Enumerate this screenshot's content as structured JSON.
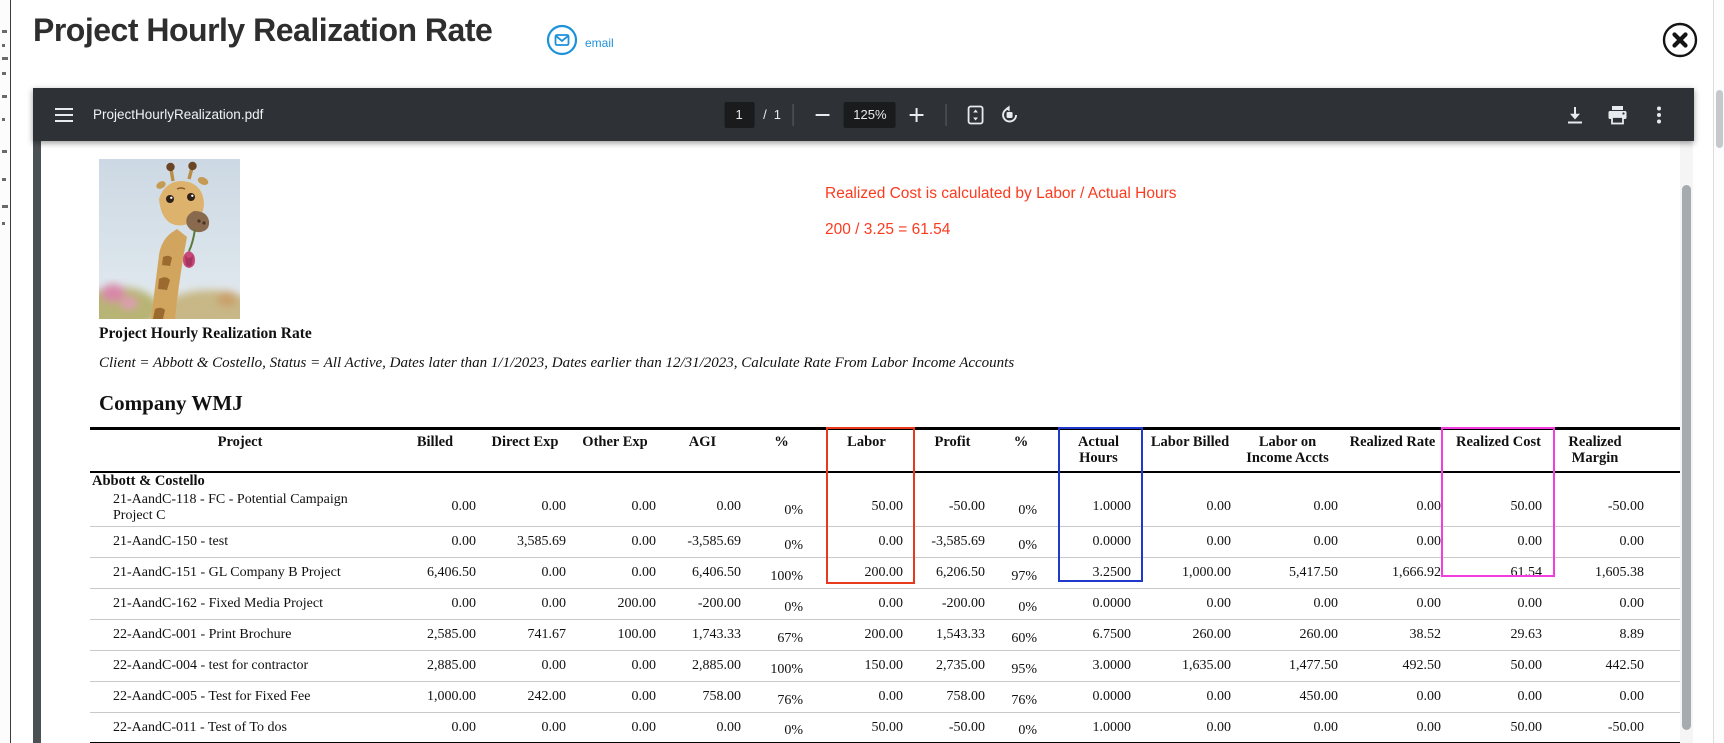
{
  "app": {
    "title": "Project Hourly Realization Rate",
    "email_label": "email",
    "accent_blue": "#1d91d9"
  },
  "pdf_toolbar": {
    "filename": "ProjectHourlyRealization.pdf",
    "page_current": "1",
    "page_divider": "/",
    "page_total": "1",
    "zoom_level": "125%"
  },
  "document": {
    "logo_icon": "giraffe-with-tulip-photo",
    "annotation": {
      "line1": "Realized Cost is calculated by Labor / Actual Hours",
      "line2": "200 / 3.25 = 61.54",
      "color": "#fb3a1e"
    },
    "report_title": "Project Hourly Realization Rate",
    "filter_line": "Client = Abbott & Costello, Status = All Active, Dates later than 1/1/2023, Dates earlier than 12/31/2023, Calculate Rate From Labor Income Accounts",
    "company_heading": "Company WMJ",
    "table": {
      "columns": [
        "Project",
        "Billed",
        "Direct Exp",
        "Other Exp",
        "AGI",
        "%",
        "Labor",
        "Profit",
        "%",
        "Actual Hours",
        "Labor Billed",
        "Labor on Income Accts",
        "Realized Rate",
        "Realized Cost",
        "Realized Margin"
      ],
      "group_header": "Abbott & Costello",
      "rows": [
        [
          "21-AandC-118 - FC - Potential Campaign Project C",
          "0.00",
          "0.00",
          "0.00",
          "0.00",
          "0%",
          "50.00",
          "-50.00",
          "0%",
          "1.0000",
          "0.00",
          "0.00",
          "0.00",
          "50.00",
          "-50.00"
        ],
        [
          "21-AandC-150 - test",
          "0.00",
          "3,585.69",
          "0.00",
          "-3,585.69",
          "0%",
          "0.00",
          "-3,585.69",
          "0%",
          "0.0000",
          "0.00",
          "0.00",
          "0.00",
          "0.00",
          "0.00"
        ],
        [
          "21-AandC-151 - GL Company B Project",
          "6,406.50",
          "0.00",
          "0.00",
          "6,406.50",
          "100%",
          "200.00",
          "6,206.50",
          "97%",
          "3.2500",
          "1,000.00",
          "5,417.50",
          "1,666.92",
          "61.54",
          "1,605.38"
        ],
        [
          "21-AandC-162 - Fixed Media Project",
          "0.00",
          "0.00",
          "200.00",
          "-200.00",
          "0%",
          "0.00",
          "-200.00",
          "0%",
          "0.0000",
          "0.00",
          "0.00",
          "0.00",
          "0.00",
          "0.00"
        ],
        [
          "22-AandC-001 - Print Brochure",
          "2,585.00",
          "741.67",
          "100.00",
          "1,743.33",
          "67%",
          "200.00",
          "1,543.33",
          "60%",
          "6.7500",
          "260.00",
          "260.00",
          "38.52",
          "29.63",
          "8.89"
        ],
        [
          "22-AandC-004 - test for contractor",
          "2,885.00",
          "0.00",
          "0.00",
          "2,885.00",
          "100%",
          "150.00",
          "2,735.00",
          "95%",
          "3.0000",
          "1,635.00",
          "1,477.50",
          "492.50",
          "50.00",
          "442.50"
        ],
        [
          "22-AandC-005 - Test for Fixed Fee",
          "1,000.00",
          "242.00",
          "0.00",
          "758.00",
          "76%",
          "0.00",
          "758.00",
          "76%",
          "0.0000",
          "0.00",
          "450.00",
          "0.00",
          "0.00",
          "0.00"
        ],
        [
          "22-AandC-011 - Test of To dos",
          "0.00",
          "0.00",
          "0.00",
          "0.00",
          "0%",
          "50.00",
          "-50.00",
          "0%",
          "1.0000",
          "0.00",
          "0.00",
          "0.00",
          "50.00",
          "-50.00"
        ]
      ],
      "highlight_boxes": {
        "labor": "#e8391d",
        "actual_hours": "#2038cc",
        "realized_cost": "#f23ddf"
      }
    }
  }
}
